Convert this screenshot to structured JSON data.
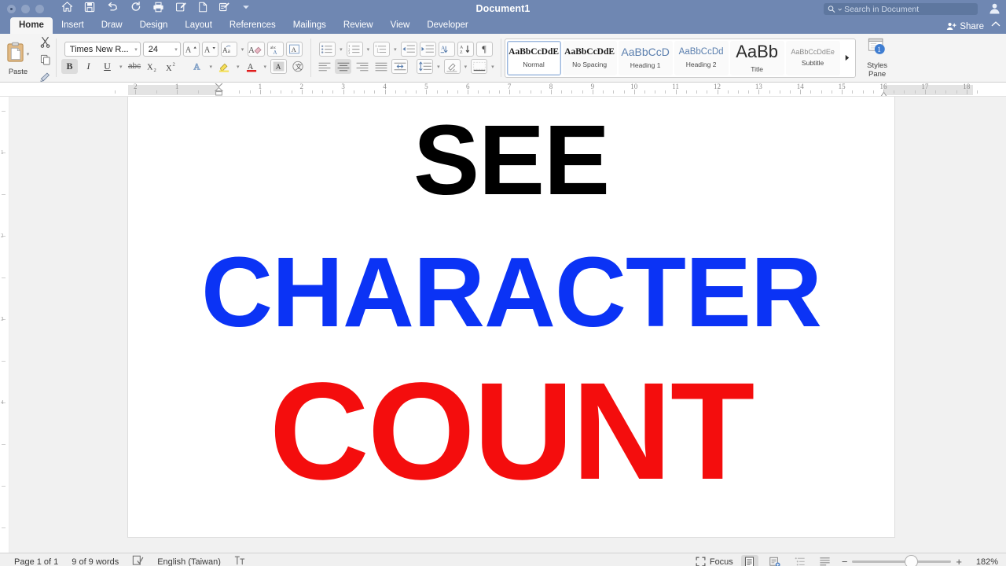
{
  "titlebar": {
    "document_title": "Document1",
    "window_controls": [
      "close",
      "minimize",
      "maximize"
    ],
    "quick_access": [
      {
        "name": "home-icon",
        "label": "Home"
      },
      {
        "name": "save-icon",
        "label": "Save"
      },
      {
        "name": "undo-icon",
        "label": "Undo"
      },
      {
        "name": "redo-icon",
        "label": "Redo"
      },
      {
        "name": "print-icon",
        "label": "Print"
      },
      {
        "name": "markup-icon",
        "label": "Markup"
      },
      {
        "name": "new-document-icon",
        "label": "New Document"
      },
      {
        "name": "edit-document-icon",
        "label": "Edit"
      },
      {
        "name": "customize-toolbar-icon",
        "label": "Customize"
      }
    ],
    "search": {
      "placeholder": "Search in Document",
      "value": ""
    },
    "avatar_label": "Account"
  },
  "tabs": [
    {
      "label": "Home",
      "active": true
    },
    {
      "label": "Insert",
      "active": false
    },
    {
      "label": "Draw",
      "active": false
    },
    {
      "label": "Design",
      "active": false
    },
    {
      "label": "Layout",
      "active": false
    },
    {
      "label": "References",
      "active": false
    },
    {
      "label": "Mailings",
      "active": false
    },
    {
      "label": "Review",
      "active": false
    },
    {
      "label": "View",
      "active": false
    },
    {
      "label": "Developer",
      "active": false
    }
  ],
  "share": {
    "label": "Share"
  },
  "ribbon": {
    "clipboard": {
      "paste_label": "Paste",
      "cut_label": "Cut",
      "copy_label": "Copy",
      "format_painter_label": "Format Painter"
    },
    "font": {
      "font_name": "Times New R...",
      "font_size": "24",
      "grow_font_label": "Grow Font",
      "shrink_font_label": "Shrink Font",
      "change_case_label": "Change Case",
      "clear_formatting_label": "Clear Formatting",
      "spelling_label": "abc",
      "borders_label": "A",
      "bold_label": "B",
      "italic_label": "I",
      "underline_label": "U",
      "strikethrough_label": "abc",
      "subscript_label": "X₂",
      "superscript_label": "X²",
      "text_effects_label": "A",
      "highlight_label": "A",
      "font_color_label": "A",
      "character_shading_label": "A",
      "character_border_label": "A",
      "bold_active": true
    },
    "paragraph": {
      "bullets_label": "Bullets",
      "numbering_label": "Numbering",
      "multilevel_label": "Multilevel List",
      "decrease_indent_label": "Decrease Indent",
      "increase_indent_label": "Increase Indent",
      "sort_label": "Sort",
      "show_marks_label": "¶",
      "align_left_label": "Align Left",
      "align_center_label": "Center",
      "align_right_label": "Align Right",
      "justify_label": "Justify",
      "columns_label": "Columns",
      "line_spacing_label": "Line Spacing",
      "shading_label": "Shading",
      "borders_label": "Borders",
      "align_center_active": true
    },
    "styles": {
      "gallery": [
        {
          "preview": "AaBbCcDdE",
          "name": "Normal",
          "selected": true,
          "style": "serif-dark"
        },
        {
          "preview": "AaBbCcDdE",
          "name": "No Spacing",
          "selected": false,
          "style": "serif-dark"
        },
        {
          "preview": "AaBbCcD",
          "name": "Heading 1",
          "selected": false,
          "style": "sans-blue-lg"
        },
        {
          "preview": "AaBbCcDd",
          "name": "Heading 2",
          "selected": false,
          "style": "sans-blue-md"
        },
        {
          "preview": "AaBb",
          "name": "Title",
          "selected": false,
          "style": "sans-dark-xl"
        },
        {
          "preview": "AaBbCcDdEe",
          "name": "Subtitle",
          "selected": false,
          "style": "sans-gray-sm"
        }
      ],
      "more_label": "More styles",
      "pane_label_line1": "Styles",
      "pane_label_line2": "Pane"
    }
  },
  "ruler": {
    "left_numbers": [
      "2",
      "1"
    ],
    "right_numbers": [
      "1",
      "2",
      "3",
      "4",
      "5",
      "6",
      "7",
      "8",
      "9",
      "10",
      "11",
      "12",
      "13",
      "14",
      "15",
      "16",
      "17",
      "18"
    ],
    "vertical_numbers": [
      "1",
      "2",
      "3",
      "4"
    ]
  },
  "document": {
    "lines": [
      {
        "text": "SEE",
        "color": "#000000"
      },
      {
        "text": "CHARACTER",
        "color": "#0b33f5"
      },
      {
        "text": "COUNT",
        "color": "#f40d0d"
      }
    ]
  },
  "statusbar": {
    "page_info": "Page 1 of 1",
    "word_count": "9 of 9 words",
    "proofing_label": "Proofing",
    "language": "English (Taiwan)",
    "track_changes_label": "Track Changes",
    "focus_label": "Focus",
    "view_print_layout_label": "Print Layout",
    "view_web_layout_label": "Web Layout",
    "view_outline_label": "Outline",
    "view_draft_label": "Draft",
    "zoom_out_label": "−",
    "zoom_in_label": "+",
    "zoom_level": "182%"
  },
  "colors": {
    "titlebar": "#6f87b2",
    "ribbon": "#f4f4f4",
    "accent_blue": "#0b33f5",
    "accent_red": "#f40d0d"
  }
}
